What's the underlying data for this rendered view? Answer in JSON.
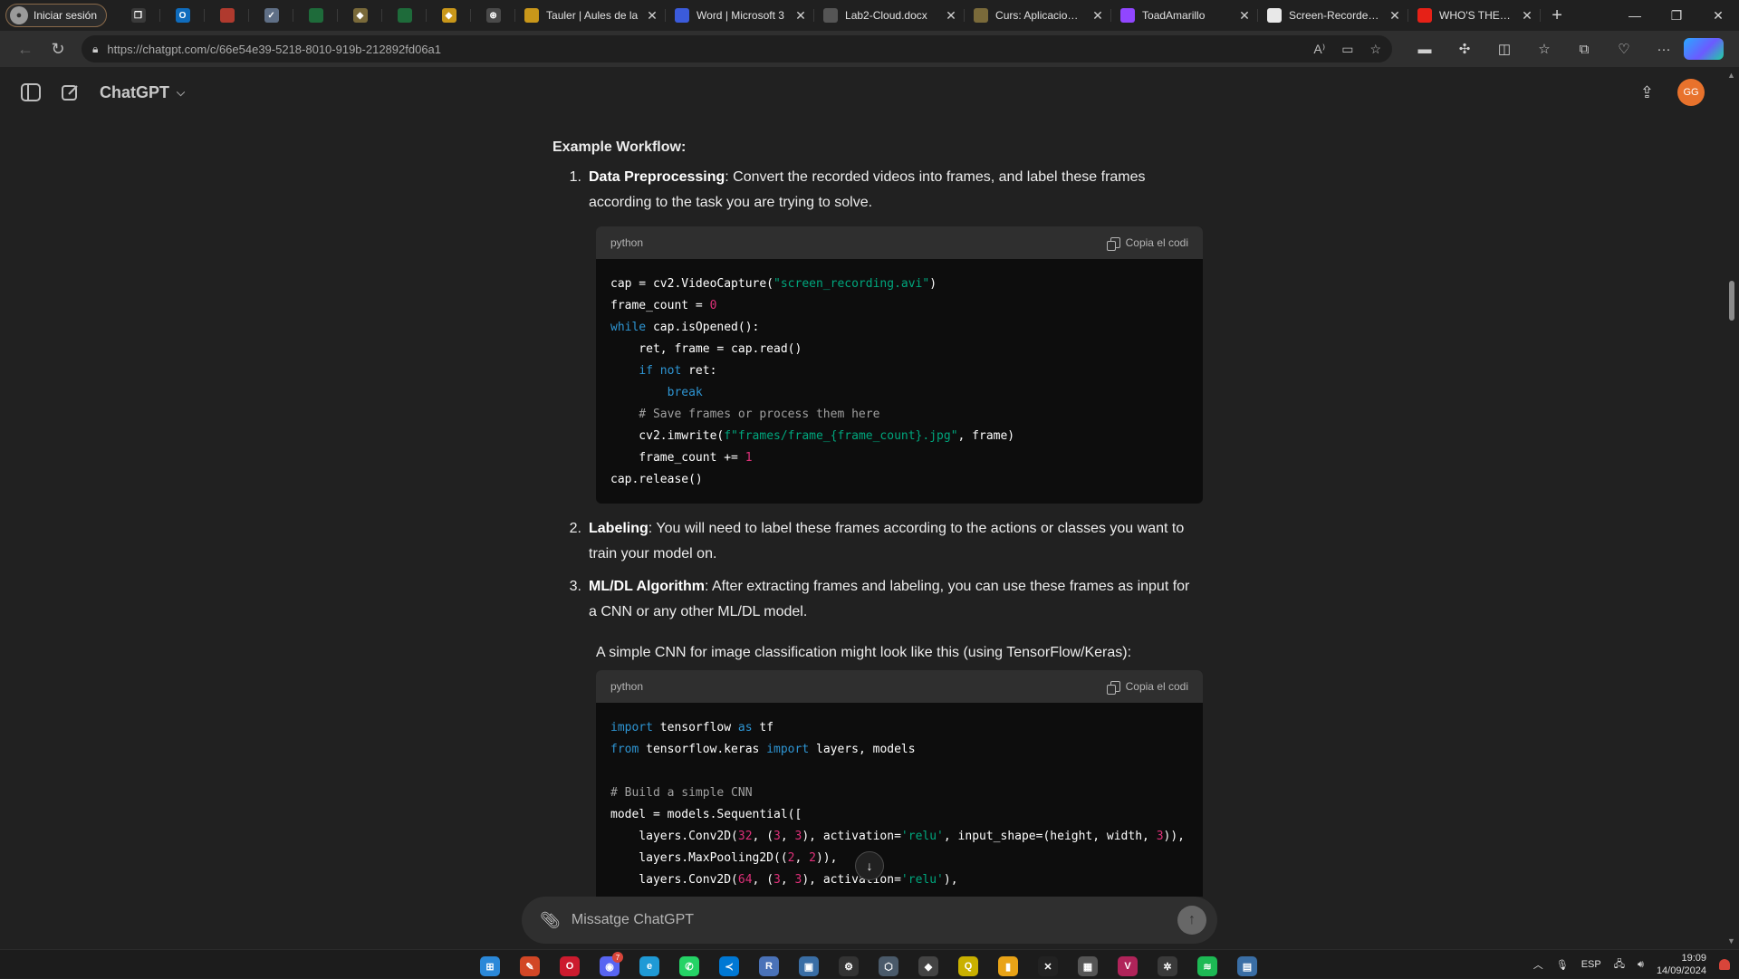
{
  "browser": {
    "profile_label": "Iniciar sesión",
    "icon_tabs": [
      {
        "name": "workspaces-icon",
        "glyph": "❐",
        "color": "#3a3a3a"
      },
      {
        "name": "outlook-icon",
        "glyph": "O",
        "color": "#0f6cbd"
      },
      {
        "name": "red-app-icon",
        "glyph": "",
        "color": "#b03a2e"
      },
      {
        "name": "gray-shield-icon",
        "glyph": "✓",
        "color": "#5f6f86"
      },
      {
        "name": "green-sheet-icon",
        "glyph": "",
        "color": "#1e6b3a"
      },
      {
        "name": "diamond-icon",
        "glyph": "◆",
        "color": "#7a6a3a"
      },
      {
        "name": "green-sheet-icon-2",
        "glyph": "",
        "color": "#1e6b3a"
      },
      {
        "name": "binance-icon",
        "glyph": "◆",
        "color": "#c9971a"
      },
      {
        "name": "chatgpt-icon",
        "glyph": "⊛",
        "color": "#4a4a4a"
      }
    ],
    "tabs": [
      {
        "label": "Tauler | Aules de la",
        "icon": "diamond-icon",
        "color": "#c9971a"
      },
      {
        "label": "Word | Microsoft 3",
        "icon": "word-icon",
        "color": "#3b5bdb"
      },
      {
        "label": "Lab2-Cloud.docx",
        "icon": "document-icon",
        "color": "#555555"
      },
      {
        "label": "Curs: Aplicacions d",
        "icon": "diamond-icon",
        "color": "#7a6a3a"
      },
      {
        "label": "ToadAmarillo",
        "icon": "twitch-icon",
        "color": "#9146ff"
      },
      {
        "label": "Screen-Recorder/R",
        "icon": "github-icon",
        "color": "#e8e8e8"
      },
      {
        "label": "WHO'S THE LIAR |",
        "icon": "youtube-icon",
        "color": "#e62117"
      }
    ],
    "url": "https://chatgpt.com/c/66e54e39-5218-8010-919b-212892fd06a1"
  },
  "app": {
    "model_name": "ChatGPT",
    "avatar_initials": "GG"
  },
  "message": {
    "workflow_heading": "Example Workflow:",
    "steps": [
      {
        "num": "1.",
        "title": "Data Preprocessing",
        "text": ": Convert the recorded videos into frames, and label these frames according to the task you are trying to solve."
      },
      {
        "num": "2.",
        "title": "Labeling",
        "text": ": You will need to label these frames according to the actions or classes you want to train your model on."
      },
      {
        "num": "3.",
        "title": "ML/DL Algorithm",
        "text": ": After extracting frames and labeling, you can use these frames as input for a CNN or any other ML/DL model."
      }
    ],
    "cnn_intro": "A simple CNN for image classification might look like this (using TensorFlow/Keras):",
    "code_blocks": [
      {
        "language": "python",
        "copy_label": "Copia el codi",
        "lines": [
          [
            [
              "t",
              "cap = cv2.VideoCapture("
            ],
            [
              "s",
              "\"screen_recording.avi\""
            ],
            [
              "t",
              ")"
            ]
          ],
          [
            [
              "t",
              "frame_count = "
            ],
            [
              "n",
              "0"
            ]
          ],
          [
            [
              "k",
              "while"
            ],
            [
              "t",
              " cap.isOpened():"
            ]
          ],
          [
            [
              "t",
              "    ret, frame = cap.read()"
            ]
          ],
          [
            [
              "t",
              "    "
            ],
            [
              "k",
              "if not"
            ],
            [
              "t",
              " ret:"
            ]
          ],
          [
            [
              "t",
              "        "
            ],
            [
              "k",
              "break"
            ]
          ],
          [
            [
              "c",
              "    # Save frames or process them here"
            ]
          ],
          [
            [
              "t",
              "    cv2.imwrite("
            ],
            [
              "s",
              "f\"frames/frame_{frame_count}.jpg\""
            ],
            [
              "t",
              ", frame)"
            ]
          ],
          [
            [
              "t",
              "    frame_count += "
            ],
            [
              "n",
              "1"
            ]
          ],
          [
            [
              "t",
              "cap.release()"
            ]
          ]
        ]
      },
      {
        "language": "python",
        "copy_label": "Copia el codi",
        "lines": [
          [
            [
              "k",
              "import"
            ],
            [
              "t",
              " tensorflow "
            ],
            [
              "k",
              "as"
            ],
            [
              "t",
              " tf"
            ]
          ],
          [
            [
              "k",
              "from"
            ],
            [
              "t",
              " tensorflow.keras "
            ],
            [
              "k",
              "import"
            ],
            [
              "t",
              " layers, models"
            ]
          ],
          [
            [
              "t",
              ""
            ]
          ],
          [
            [
              "c",
              "# Build a simple CNN"
            ]
          ],
          [
            [
              "t",
              "model = models.Sequential(["
            ]
          ],
          [
            [
              "t",
              "    layers.Conv2D("
            ],
            [
              "n",
              "32"
            ],
            [
              "t",
              ", ("
            ],
            [
              "n",
              "3"
            ],
            [
              "t",
              ", "
            ],
            [
              "n",
              "3"
            ],
            [
              "t",
              "), activation="
            ],
            [
              "s",
              "'relu'"
            ],
            [
              "t",
              ", input_shape=(height, width, "
            ],
            [
              "n",
              "3"
            ],
            [
              "t",
              ")),"
            ]
          ],
          [
            [
              "t",
              "    layers.MaxPooling2D(("
            ],
            [
              "n",
              "2"
            ],
            [
              "t",
              ", "
            ],
            [
              "n",
              "2"
            ],
            [
              "t",
              ")),"
            ]
          ],
          [
            [
              "t",
              "    layers.Conv2D("
            ],
            [
              "n",
              "64"
            ],
            [
              "t",
              ", ("
            ],
            [
              "n",
              "3"
            ],
            [
              "t",
              ", "
            ],
            [
              "n",
              "3"
            ],
            [
              "t",
              "), activation="
            ],
            [
              "s",
              "'relu'"
            ],
            [
              "t",
              "),"
            ]
          ]
        ]
      }
    ]
  },
  "composer": {
    "placeholder": "Missatge ChatGPT"
  },
  "taskbar": {
    "apps": [
      {
        "name": "windows-start-icon",
        "glyph": "⊞",
        "color": "#2b88d8"
      },
      {
        "name": "app-red-icon",
        "glyph": "✎",
        "color": "#d24726"
      },
      {
        "name": "opera-icon",
        "glyph": "O",
        "color": "#cc1b2e"
      },
      {
        "name": "discord-icon",
        "glyph": "◉",
        "color": "#5865f2",
        "badge": "7"
      },
      {
        "name": "edge-icon",
        "glyph": "e",
        "color": "#1f9ad6"
      },
      {
        "name": "whatsapp-icon",
        "glyph": "✆",
        "color": "#25d366"
      },
      {
        "name": "vscode-icon",
        "glyph": "≺",
        "color": "#0078d4"
      },
      {
        "name": "r-icon",
        "glyph": "R",
        "color": "#4a72b8"
      },
      {
        "name": "photos-icon",
        "glyph": "▣",
        "color": "#3a6ea5"
      },
      {
        "name": "steam-icon",
        "glyph": "⚙",
        "color": "#333333"
      },
      {
        "name": "box-icon",
        "glyph": "⬡",
        "color": "#4a5a6a"
      },
      {
        "name": "unity-icon",
        "glyph": "◆",
        "color": "#444444"
      },
      {
        "name": "qgis-icon",
        "glyph": "Q",
        "color": "#c9b000"
      },
      {
        "name": "powerbi-icon",
        "glyph": "▮",
        "color": "#e8a317"
      },
      {
        "name": "capcut-icon",
        "glyph": "✕",
        "color": "#222222"
      },
      {
        "name": "photo-app-icon",
        "glyph": "▦",
        "color": "#555555"
      },
      {
        "name": "vegas-icon",
        "glyph": "V",
        "color": "#b0245a"
      },
      {
        "name": "gear-app-icon",
        "glyph": "✲",
        "color": "#3a3a3a"
      },
      {
        "name": "spotify-icon",
        "glyph": "≋",
        "color": "#1db954"
      },
      {
        "name": "explorer-icon",
        "glyph": "▤",
        "color": "#3a6ea5"
      }
    ],
    "lang": "ESP",
    "time": "19:09",
    "date": "14/09/2024"
  }
}
